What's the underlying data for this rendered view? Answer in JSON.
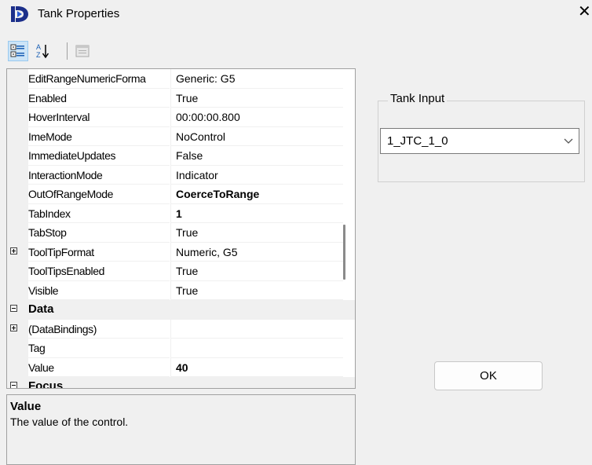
{
  "window": {
    "title": "Tank Properties",
    "close_glyph": "✕"
  },
  "toolbar": {
    "categorized_icon": "categorized-icon",
    "alphabetical_icon": "alphabetical-icon",
    "property_pages_icon": "property-pages-icon"
  },
  "grid": {
    "rows": [
      {
        "type": "prop",
        "name": "EditRangeNumericForma",
        "value": "Generic: G5",
        "bold": false,
        "expander": ""
      },
      {
        "type": "prop",
        "name": "Enabled",
        "value": "True",
        "bold": false,
        "expander": ""
      },
      {
        "type": "prop",
        "name": "HoverInterval",
        "value": "00:00:00.800",
        "bold": false,
        "expander": ""
      },
      {
        "type": "prop",
        "name": "ImeMode",
        "value": "NoControl",
        "bold": false,
        "expander": ""
      },
      {
        "type": "prop",
        "name": "ImmediateUpdates",
        "value": "False",
        "bold": false,
        "expander": ""
      },
      {
        "type": "prop",
        "name": "InteractionMode",
        "value": "Indicator",
        "bold": false,
        "expander": ""
      },
      {
        "type": "prop",
        "name": "OutOfRangeMode",
        "value": "CoerceToRange",
        "bold": true,
        "expander": ""
      },
      {
        "type": "prop",
        "name": "TabIndex",
        "value": "1",
        "bold": true,
        "expander": ""
      },
      {
        "type": "prop",
        "name": "TabStop",
        "value": "True",
        "bold": false,
        "expander": ""
      },
      {
        "type": "prop",
        "name": "ToolTipFormat",
        "value": "Numeric, G5",
        "bold": false,
        "expander": "plus"
      },
      {
        "type": "prop",
        "name": "ToolTipsEnabled",
        "value": "True",
        "bold": false,
        "expander": ""
      },
      {
        "type": "prop",
        "name": "Visible",
        "value": "True",
        "bold": false,
        "expander": ""
      },
      {
        "type": "category",
        "name": "Data",
        "value": "",
        "bold": true,
        "expander": "minus"
      },
      {
        "type": "prop",
        "name": "(DataBindings)",
        "value": "",
        "bold": false,
        "expander": "plus"
      },
      {
        "type": "prop",
        "name": "Tag",
        "value": "",
        "bold": false,
        "expander": ""
      },
      {
        "type": "prop",
        "name": "Value",
        "value": "40",
        "bold": true,
        "expander": ""
      },
      {
        "type": "category",
        "name": "Focus",
        "value": "",
        "bold": true,
        "expander": "minus"
      }
    ]
  },
  "description": {
    "title": "Value",
    "text": "The value of the control."
  },
  "tank_input": {
    "label": "Tank Input",
    "selected": "1_JTC_1_0"
  },
  "ok_button": {
    "label": "OK"
  }
}
